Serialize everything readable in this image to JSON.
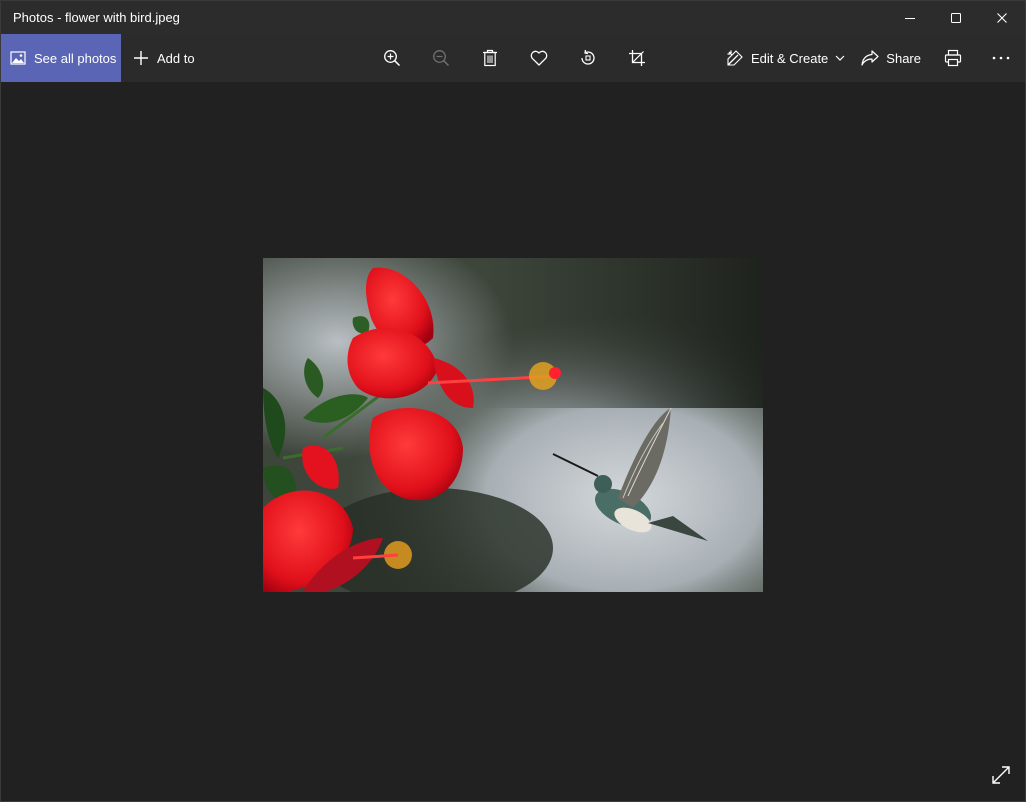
{
  "window": {
    "title": "Photos - flower with bird.jpeg"
  },
  "titlebar": {
    "minimize_icon": "minimize-icon",
    "maximize_icon": "maximize-icon",
    "close_icon": "close-icon"
  },
  "toolbar": {
    "see_all_label": "See all photos",
    "add_to_label": "Add to",
    "edit_create_label": "Edit & Create",
    "share_label": "Share",
    "accent_color": "#5b65b6",
    "icons": [
      "zoom-in-icon",
      "zoom-out-icon",
      "delete-icon",
      "heart-icon",
      "rotate-icon",
      "crop-icon",
      "edit-icon",
      "share-icon",
      "print-icon",
      "more-icon"
    ]
  },
  "viewer": {
    "image_description_icon": "photo",
    "fullscreen_icon": "expand-icon"
  }
}
